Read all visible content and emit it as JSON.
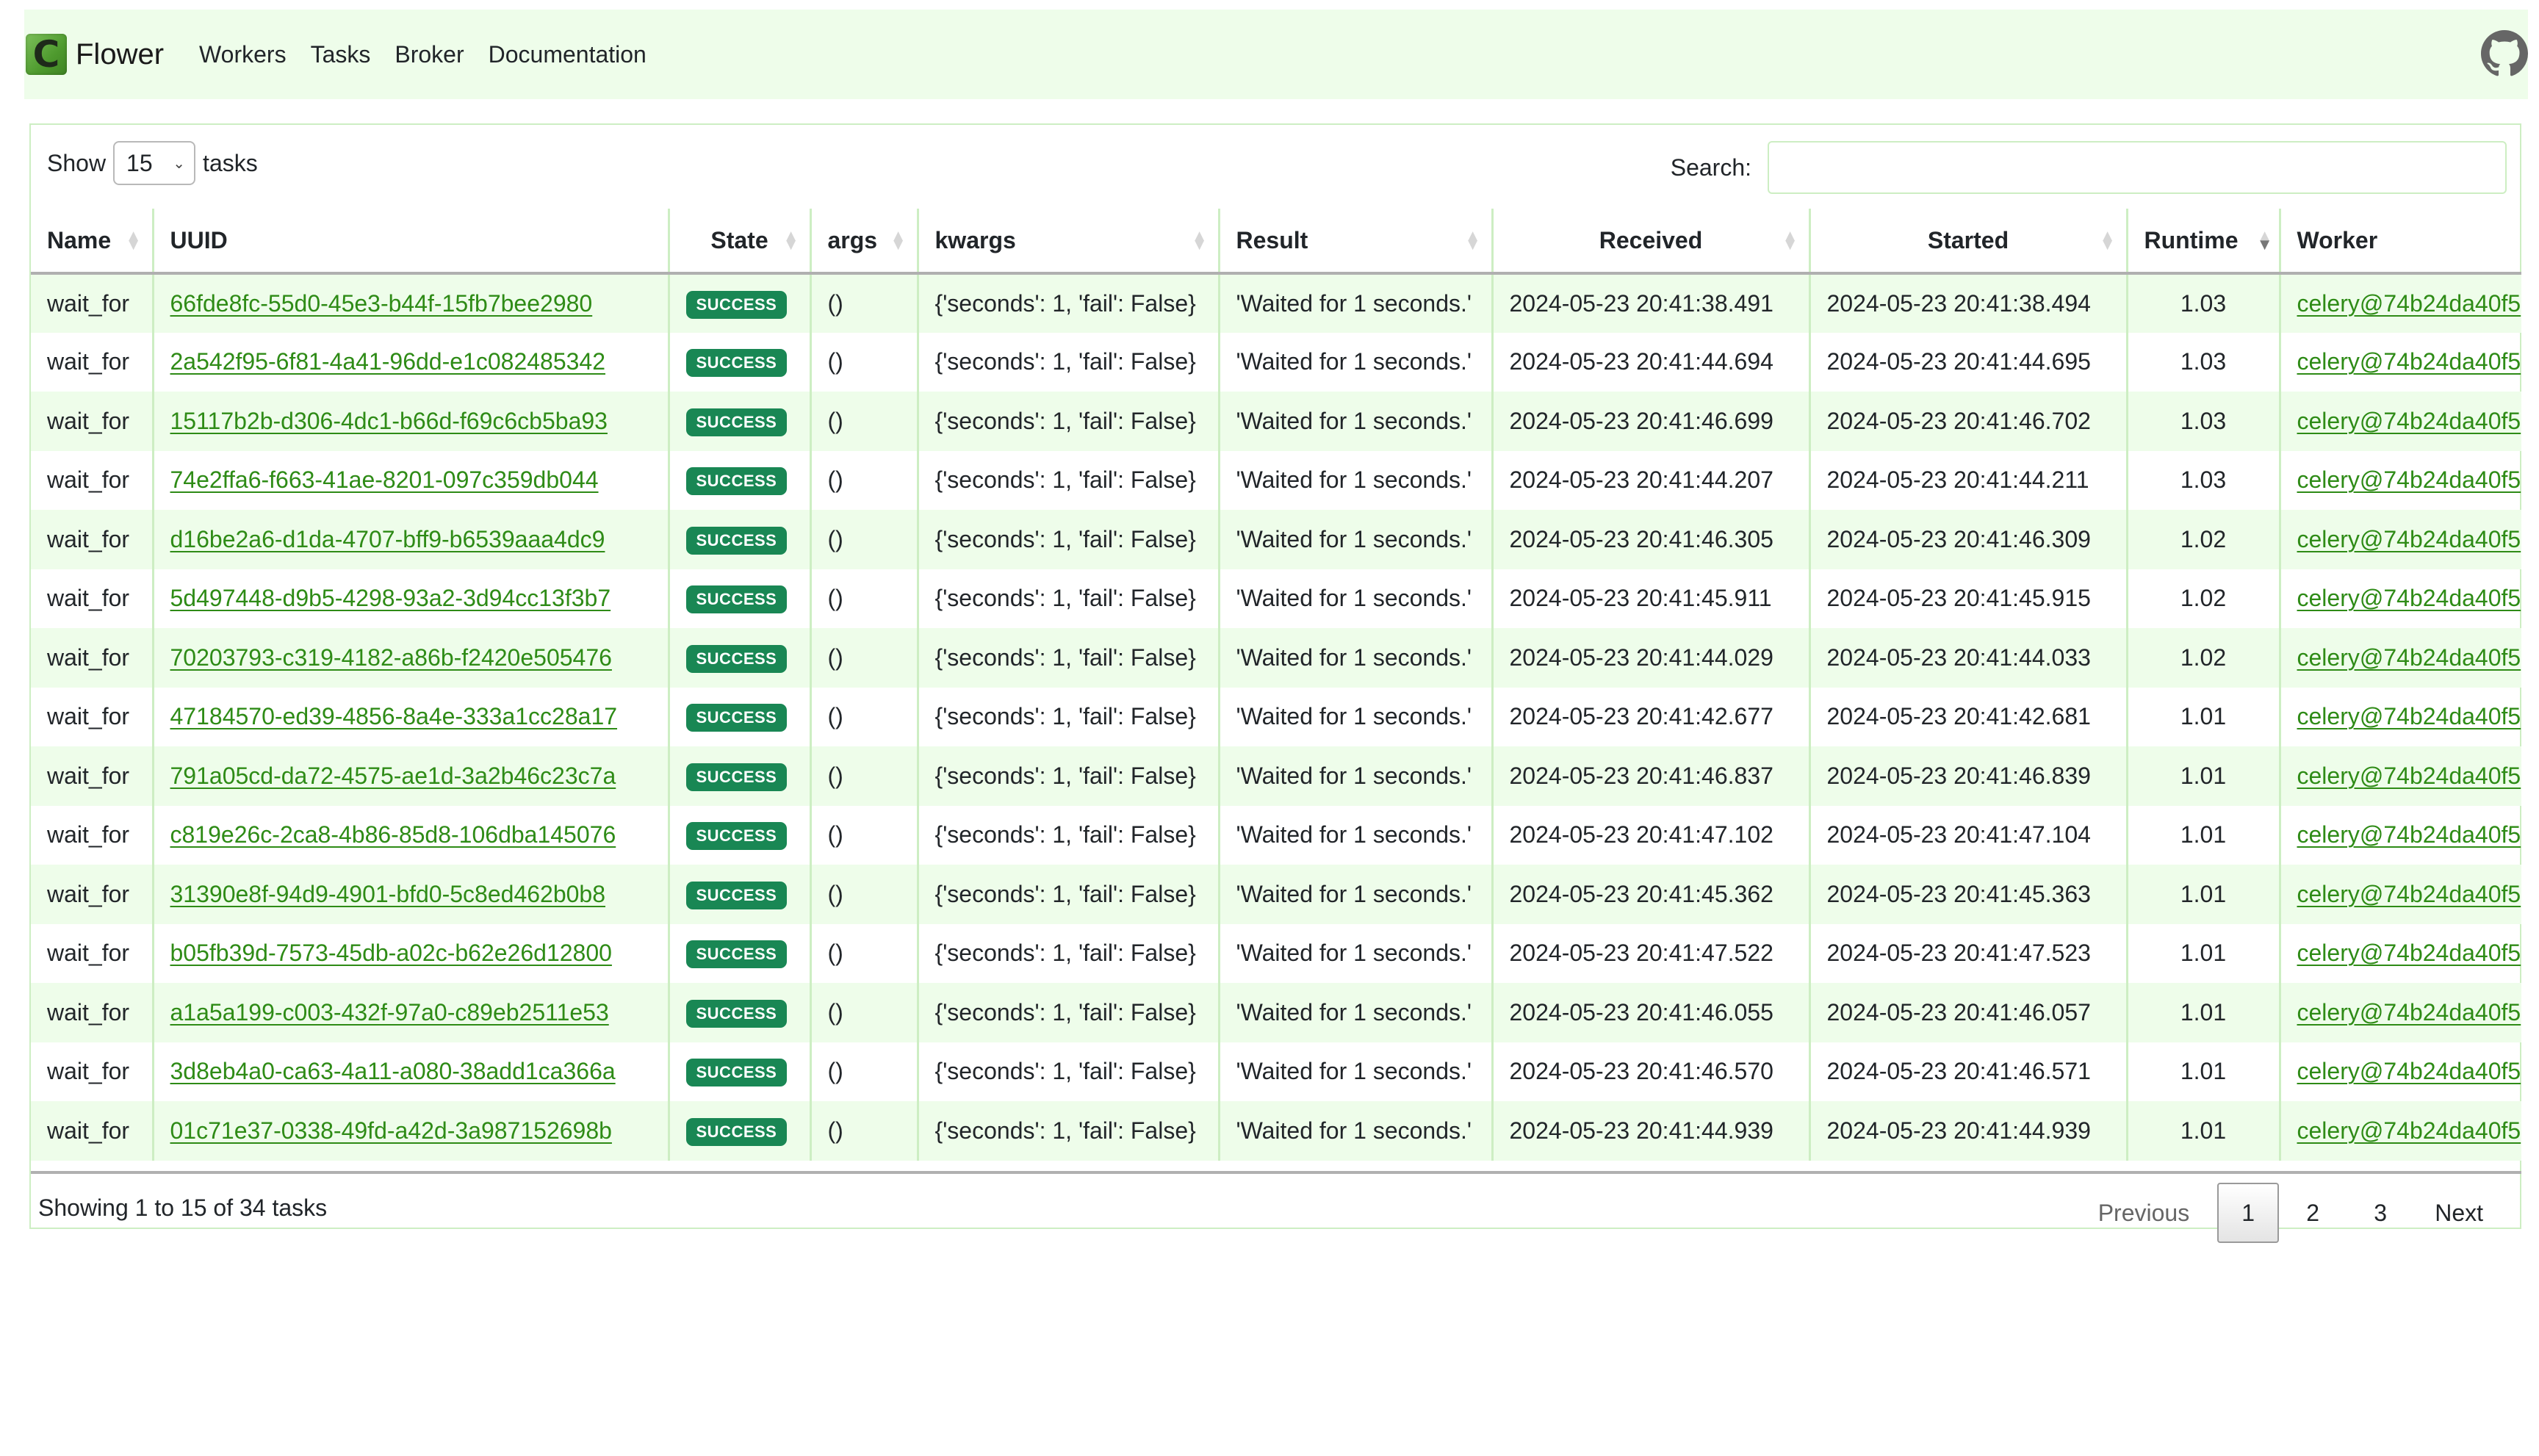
{
  "navbar": {
    "brand": "Flower",
    "logo_letter": "C",
    "links": [
      "Workers",
      "Tasks",
      "Broker",
      "Documentation"
    ],
    "github_icon": "github-icon"
  },
  "controls": {
    "show_label": "Show",
    "page_size": "15",
    "tasks_label": "tasks",
    "search_label": "Search:",
    "search_value": "",
    "search_placeholder": ""
  },
  "table": {
    "columns": [
      "Name",
      "UUID",
      "State",
      "args",
      "kwargs",
      "Result",
      "Received",
      "Started",
      "Runtime",
      "Worker"
    ],
    "sort": {
      "column": "Runtime",
      "direction": "descending"
    },
    "rows": [
      {
        "name": "wait_for",
        "uuid": "66fde8fc-55d0-45e3-b44f-15fb7bee2980",
        "state": "SUCCESS",
        "args": "()",
        "kwargs": "{'seconds': 1, 'fail': False}",
        "result": "'Waited for 1 seconds.'",
        "received": "2024-05-23 20:41:38.491",
        "started": "2024-05-23 20:41:38.494",
        "runtime": "1.03",
        "worker": "celery@74b24da40f5"
      },
      {
        "name": "wait_for",
        "uuid": "2a542f95-6f81-4a41-96dd-e1c082485342",
        "state": "SUCCESS",
        "args": "()",
        "kwargs": "{'seconds': 1, 'fail': False}",
        "result": "'Waited for 1 seconds.'",
        "received": "2024-05-23 20:41:44.694",
        "started": "2024-05-23 20:41:44.695",
        "runtime": "1.03",
        "worker": "celery@74b24da40f5"
      },
      {
        "name": "wait_for",
        "uuid": "15117b2b-d306-4dc1-b66d-f69c6cb5ba93",
        "state": "SUCCESS",
        "args": "()",
        "kwargs": "{'seconds': 1, 'fail': False}",
        "result": "'Waited for 1 seconds.'",
        "received": "2024-05-23 20:41:46.699",
        "started": "2024-05-23 20:41:46.702",
        "runtime": "1.03",
        "worker": "celery@74b24da40f5"
      },
      {
        "name": "wait_for",
        "uuid": "74e2ffa6-f663-41ae-8201-097c359db044",
        "state": "SUCCESS",
        "args": "()",
        "kwargs": "{'seconds': 1, 'fail': False}",
        "result": "'Waited for 1 seconds.'",
        "received": "2024-05-23 20:41:44.207",
        "started": "2024-05-23 20:41:44.211",
        "runtime": "1.03",
        "worker": "celery@74b24da40f5"
      },
      {
        "name": "wait_for",
        "uuid": "d16be2a6-d1da-4707-bff9-b6539aaa4dc9",
        "state": "SUCCESS",
        "args": "()",
        "kwargs": "{'seconds': 1, 'fail': False}",
        "result": "'Waited for 1 seconds.'",
        "received": "2024-05-23 20:41:46.305",
        "started": "2024-05-23 20:41:46.309",
        "runtime": "1.02",
        "worker": "celery@74b24da40f5"
      },
      {
        "name": "wait_for",
        "uuid": "5d497448-d9b5-4298-93a2-3d94cc13f3b7",
        "state": "SUCCESS",
        "args": "()",
        "kwargs": "{'seconds': 1, 'fail': False}",
        "result": "'Waited for 1 seconds.'",
        "received": "2024-05-23 20:41:45.911",
        "started": "2024-05-23 20:41:45.915",
        "runtime": "1.02",
        "worker": "celery@74b24da40f5"
      },
      {
        "name": "wait_for",
        "uuid": "70203793-c319-4182-a86b-f2420e505476",
        "state": "SUCCESS",
        "args": "()",
        "kwargs": "{'seconds': 1, 'fail': False}",
        "result": "'Waited for 1 seconds.'",
        "received": "2024-05-23 20:41:44.029",
        "started": "2024-05-23 20:41:44.033",
        "runtime": "1.02",
        "worker": "celery@74b24da40f5"
      },
      {
        "name": "wait_for",
        "uuid": "47184570-ed39-4856-8a4e-333a1cc28a17",
        "state": "SUCCESS",
        "args": "()",
        "kwargs": "{'seconds': 1, 'fail': False}",
        "result": "'Waited for 1 seconds.'",
        "received": "2024-05-23 20:41:42.677",
        "started": "2024-05-23 20:41:42.681",
        "runtime": "1.01",
        "worker": "celery@74b24da40f5"
      },
      {
        "name": "wait_for",
        "uuid": "791a05cd-da72-4575-ae1d-3a2b46c23c7a",
        "state": "SUCCESS",
        "args": "()",
        "kwargs": "{'seconds': 1, 'fail': False}",
        "result": "'Waited for 1 seconds.'",
        "received": "2024-05-23 20:41:46.837",
        "started": "2024-05-23 20:41:46.839",
        "runtime": "1.01",
        "worker": "celery@74b24da40f5"
      },
      {
        "name": "wait_for",
        "uuid": "c819e26c-2ca8-4b86-85d8-106dba145076",
        "state": "SUCCESS",
        "args": "()",
        "kwargs": "{'seconds': 1, 'fail': False}",
        "result": "'Waited for 1 seconds.'",
        "received": "2024-05-23 20:41:47.102",
        "started": "2024-05-23 20:41:47.104",
        "runtime": "1.01",
        "worker": "celery@74b24da40f5"
      },
      {
        "name": "wait_for",
        "uuid": "31390e8f-94d9-4901-bfd0-5c8ed462b0b8",
        "state": "SUCCESS",
        "args": "()",
        "kwargs": "{'seconds': 1, 'fail': False}",
        "result": "'Waited for 1 seconds.'",
        "received": "2024-05-23 20:41:45.362",
        "started": "2024-05-23 20:41:45.363",
        "runtime": "1.01",
        "worker": "celery@74b24da40f5"
      },
      {
        "name": "wait_for",
        "uuid": "b05fb39d-7573-45db-a02c-b62e26d12800",
        "state": "SUCCESS",
        "args": "()",
        "kwargs": "{'seconds': 1, 'fail': False}",
        "result": "'Waited for 1 seconds.'",
        "received": "2024-05-23 20:41:47.522",
        "started": "2024-05-23 20:41:47.523",
        "runtime": "1.01",
        "worker": "celery@74b24da40f5"
      },
      {
        "name": "wait_for",
        "uuid": "a1a5a199-c003-432f-97a0-c89eb2511e53",
        "state": "SUCCESS",
        "args": "()",
        "kwargs": "{'seconds': 1, 'fail': False}",
        "result": "'Waited for 1 seconds.'",
        "received": "2024-05-23 20:41:46.055",
        "started": "2024-05-23 20:41:46.057",
        "runtime": "1.01",
        "worker": "celery@74b24da40f5"
      },
      {
        "name": "wait_for",
        "uuid": "3d8eb4a0-ca63-4a11-a080-38add1ca366a",
        "state": "SUCCESS",
        "args": "()",
        "kwargs": "{'seconds': 1, 'fail': False}",
        "result": "'Waited for 1 seconds.'",
        "received": "2024-05-23 20:41:46.570",
        "started": "2024-05-23 20:41:46.571",
        "runtime": "1.01",
        "worker": "celery@74b24da40f5"
      },
      {
        "name": "wait_for",
        "uuid": "01c71e37-0338-49fd-a42d-3a987152698b",
        "state": "SUCCESS",
        "args": "()",
        "kwargs": "{'seconds': 1, 'fail': False}",
        "result": "'Waited for 1 seconds.'",
        "received": "2024-05-23 20:41:44.939",
        "started": "2024-05-23 20:41:44.939",
        "runtime": "1.01",
        "worker": "celery@74b24da40f5"
      }
    ]
  },
  "footer": {
    "info": "Showing 1 to 15 of 34 tasks",
    "pagination": {
      "previous": "Previous",
      "pages": [
        "1",
        "2",
        "3"
      ],
      "current": "1",
      "next": "Next"
    }
  },
  "colors": {
    "navbar_bg": "#eefdea",
    "stripe_bg": "#eefdea",
    "border": "#cdeec3",
    "link": "#2e8b16",
    "success_badge": "#198754"
  }
}
